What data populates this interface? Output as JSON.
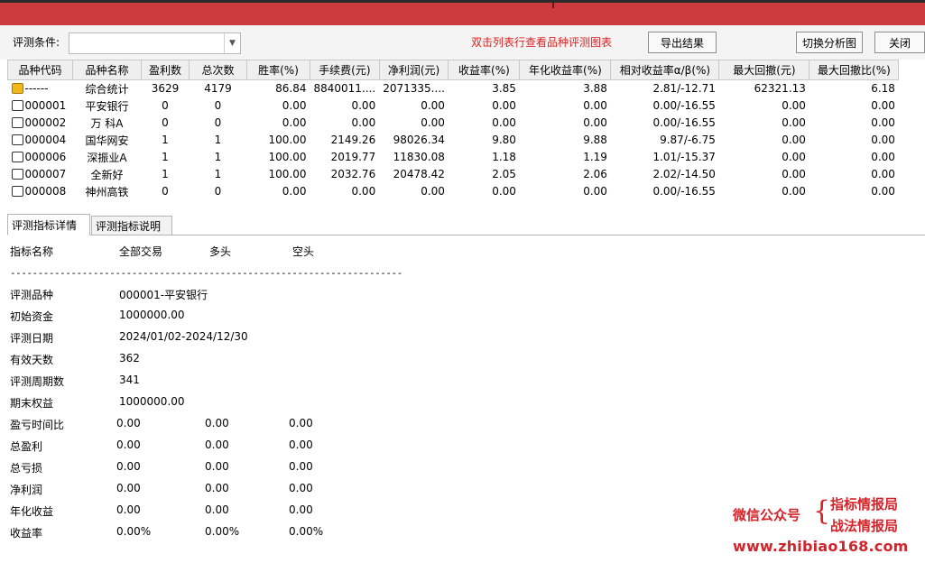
{
  "toolbar": {
    "condition_label": "评测条件:",
    "condition_value": "",
    "hint": "双击列表行查看品种评测图表",
    "export_label": "导出结果",
    "switch_label": "切换分析图",
    "close_label": "关闭"
  },
  "table": {
    "columns": [
      "品种代码",
      "品种名称",
      "盈利数",
      "总次数",
      "胜率(%)",
      "手续费(元)",
      "净利润(元)",
      "收益率(%)",
      "年化收益率(%)",
      "相对收益率α/β(%)",
      "最大回撤(元)",
      "最大回撤比(%)"
    ],
    "rows": [
      {
        "code": "------",
        "name": "综合统计",
        "wins": "3629",
        "total": "4179",
        "winrate": "86.84",
        "fee": "8840011....",
        "profit": "2071335....",
        "ret": "3.85",
        "annual": "3.88",
        "rel": "2.81/-12.71",
        "maxdd": "62321.13",
        "maxddr": "6.18",
        "icon": "summary-icon"
      },
      {
        "code": "000001",
        "name": "平安银行",
        "wins": "0",
        "total": "0",
        "winrate": "0.00",
        "fee": "0.00",
        "profit": "0.00",
        "ret": "0.00",
        "annual": "0.00",
        "rel": "0.00/-16.55",
        "maxdd": "0.00",
        "maxddr": "0.00",
        "icon": "document-icon"
      },
      {
        "code": "000002",
        "name": "万 科A",
        "wins": "0",
        "total": "0",
        "winrate": "0.00",
        "fee": "0.00",
        "profit": "0.00",
        "ret": "0.00",
        "annual": "0.00",
        "rel": "0.00/-16.55",
        "maxdd": "0.00",
        "maxddr": "0.00",
        "icon": "document-icon"
      },
      {
        "code": "000004",
        "name": "国华网安",
        "wins": "1",
        "total": "1",
        "winrate": "100.00",
        "fee": "2149.26",
        "profit": "98026.34",
        "ret": "9.80",
        "annual": "9.88",
        "rel": "9.87/-6.75",
        "maxdd": "0.00",
        "maxddr": "0.00",
        "icon": "document-icon"
      },
      {
        "code": "000006",
        "name": "深振业A",
        "wins": "1",
        "total": "1",
        "winrate": "100.00",
        "fee": "2019.77",
        "profit": "11830.08",
        "ret": "1.18",
        "annual": "1.19",
        "rel": "1.01/-15.37",
        "maxdd": "0.00",
        "maxddr": "0.00",
        "icon": "document-icon"
      },
      {
        "code": "000007",
        "name": "全新好",
        "wins": "1",
        "total": "1",
        "winrate": "100.00",
        "fee": "2032.76",
        "profit": "20478.42",
        "ret": "2.05",
        "annual": "2.06",
        "rel": "2.02/-14.50",
        "maxdd": "0.00",
        "maxddr": "0.00",
        "icon": "document-icon"
      },
      {
        "code": "000008",
        "name": "神州高铁",
        "wins": "0",
        "total": "0",
        "winrate": "0.00",
        "fee": "0.00",
        "profit": "0.00",
        "ret": "0.00",
        "annual": "0.00",
        "rel": "0.00/-16.55",
        "maxdd": "0.00",
        "maxddr": "0.00",
        "icon": "document-icon"
      }
    ]
  },
  "tabs": {
    "detail": "评测指标详情",
    "explain": "评测指标说明"
  },
  "details": {
    "header": {
      "name": "指标名称",
      "all": "全部交易",
      "long": "多头",
      "short": "空头"
    },
    "separator": "-----------------------------------------------------------------------",
    "rows": [
      {
        "label": "评测品种",
        "v1": "000001-平安银行",
        "v2": "",
        "v3": ""
      },
      {
        "label": "初始资金",
        "v1": "1000000.00",
        "v2": "",
        "v3": ""
      },
      {
        "label": "评测日期",
        "v1": "2024/01/02-2024/12/30",
        "v2": "",
        "v3": ""
      },
      {
        "label": "有效天数",
        "v1": "362",
        "v2": "",
        "v3": ""
      },
      {
        "label": "评测周期数",
        "v1": "341",
        "v2": "",
        "v3": ""
      },
      {
        "label": "期末权益",
        "v1": "1000000.00",
        "v2": "",
        "v3": ""
      },
      {
        "label": "盈亏时间比",
        "v1": "0.00",
        "v2": "0.00",
        "v3": "0.00"
      },
      {
        "label": "总盈利",
        "v1": "0.00",
        "v2": "0.00",
        "v3": "0.00"
      },
      {
        "label": "总亏损",
        "v1": "0.00",
        "v2": "0.00",
        "v3": "0.00"
      },
      {
        "label": "净利润",
        "v1": "0.00",
        "v2": "0.00",
        "v3": "0.00"
      },
      {
        "label": "年化收益",
        "v1": "0.00",
        "v2": "0.00",
        "v3": "0.00"
      },
      {
        "label": "收益率",
        "v1": "0.00%",
        "v2": "0.00%",
        "v3": "0.00%"
      }
    ]
  },
  "watermark": {
    "left": "微信公众号",
    "brace": "{",
    "right1": "指标情报局",
    "right2": "战法情报局",
    "url": "www.zhibiao168.com"
  },
  "colors": {
    "titlebar": "#cc3a3f",
    "hint": "#e02020",
    "watermark": "#d2242a"
  }
}
